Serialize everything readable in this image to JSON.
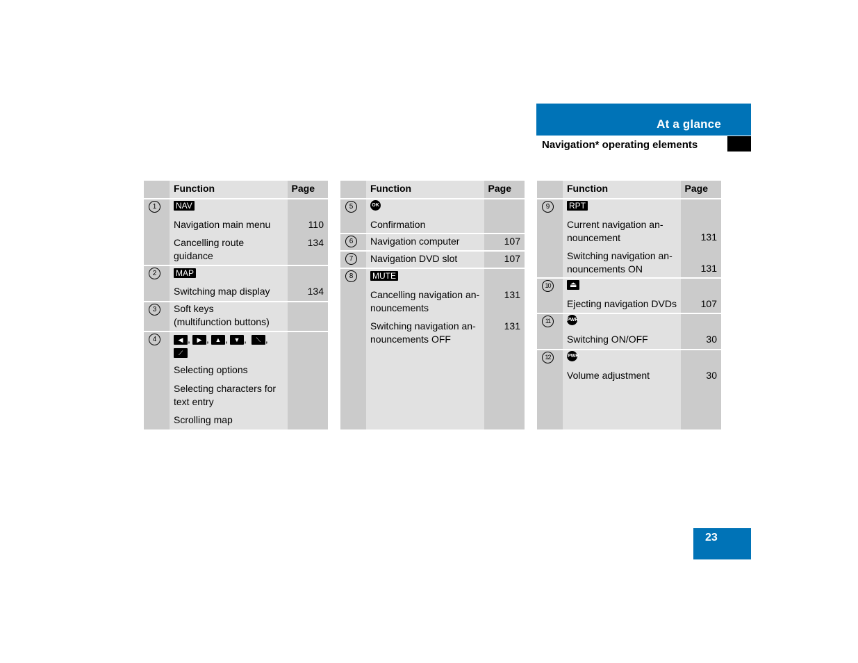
{
  "header": {
    "section_title": "At a glance",
    "subtitle": "Navigation* operating elements",
    "accent_color": "#0073b7"
  },
  "page_number": "23",
  "table_headers": {
    "function": "Function",
    "page": "Page"
  },
  "tables": [
    {
      "rows": [
        {
          "num": "1",
          "key": "NAV",
          "items": [
            {
              "text": "Navigation main menu",
              "page": "110"
            },
            {
              "text": "Cancelling route\nguidance",
              "page": "134"
            }
          ]
        },
        {
          "num": "2",
          "key": "MAP",
          "items": [
            {
              "text": "Switching map display",
              "page": "134"
            }
          ]
        },
        {
          "num": "3",
          "items": [
            {
              "text": "Soft keys\n(multifunction buttons)",
              "page": ""
            }
          ]
        },
        {
          "num": "4",
          "keys": [
            "◀",
            "▶",
            "▲",
            "▼",
            "⟍",
            "⟋"
          ],
          "items": [
            {
              "text": "Selecting options",
              "page": ""
            },
            {
              "text": "Selecting characters for\ntext entry",
              "page": ""
            },
            {
              "text": "Scrolling map",
              "page": ""
            }
          ]
        }
      ]
    },
    {
      "rows": [
        {
          "num": "5",
          "key": "OK",
          "items": [
            {
              "text": "Confirmation",
              "page": ""
            }
          ]
        },
        {
          "num": "6",
          "items": [
            {
              "text": "Navigation computer",
              "page": "107"
            }
          ]
        },
        {
          "num": "7",
          "items": [
            {
              "text": "Navigation DVD slot",
              "page": "107"
            }
          ]
        },
        {
          "num": "8",
          "key": "MUTE",
          "items": [
            {
              "text": "Cancelling navigation an-\nnouncements",
              "page": "131"
            },
            {
              "text": "Switching navigation an-\nnouncements OFF",
              "page": "131"
            }
          ]
        }
      ]
    },
    {
      "rows": [
        {
          "num": "9",
          "key": "RPT",
          "items": [
            {
              "text": "Current navigation an-\nnouncement",
              "page": "131"
            },
            {
              "text": "Switching navigation an-\nnouncements ON",
              "page": "131"
            }
          ]
        },
        {
          "num": "10",
          "key": "⏏",
          "items": [
            {
              "text": "Ejecting navigation DVDs",
              "page": "107"
            }
          ]
        },
        {
          "num": "11",
          "key": "PWR",
          "items": [
            {
              "text": "Switching ON/OFF",
              "page": "30"
            }
          ]
        },
        {
          "num": "12",
          "key": "PWR",
          "items": [
            {
              "text": "Volume adjustment",
              "page": "30"
            }
          ]
        }
      ]
    }
  ]
}
